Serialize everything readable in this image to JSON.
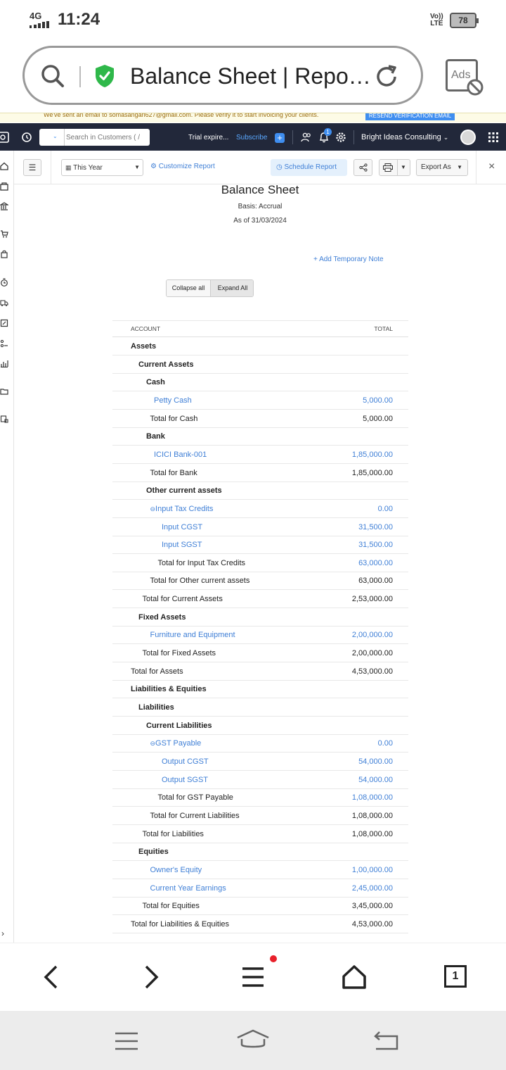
{
  "status_bar": {
    "network": "4G",
    "time": "11:24",
    "volte": "Vo\nLTE",
    "battery": "78"
  },
  "browser": {
    "page_title": "Balance Sheet | Repo…",
    "ads_label": "Ads"
  },
  "banner": {
    "text": "We've sent an email to somasangari627@gmail.com. Please verify it to start invoicing your clients.",
    "button": "RESEND VERIFICATION EMAIL"
  },
  "topnav": {
    "search_placeholder": "Search in Customers ( /",
    "trial": "Trial expire...",
    "subscribe": "Subscribe",
    "notifications": "1",
    "org": "Bright Ideas Consulting"
  },
  "toolbar": {
    "period": "This Year",
    "customize": "Customize Report",
    "schedule": "Schedule Report",
    "export": "Export As"
  },
  "report": {
    "title": "Balance Sheet",
    "basis": "Basis: Accrual",
    "as_of": "As of 31/03/2024",
    "add_note": "Add Temporary Note",
    "collapse": "Collapse all",
    "expand": "Expand All",
    "col_account": "ACCOUNT",
    "col_total": "TOTAL",
    "rows": [
      {
        "label": "Assets",
        "amount": "",
        "indent": 0,
        "style": "bold"
      },
      {
        "label": "Current Assets",
        "amount": "",
        "indent": 1,
        "style": "bold"
      },
      {
        "label": "Cash",
        "amount": "",
        "indent": 2,
        "style": "bold"
      },
      {
        "label": "Petty Cash",
        "amount": "5,000.00",
        "indent": 3,
        "style": "link"
      },
      {
        "label": "Total for Cash",
        "amount": "5,000.00",
        "indent": 2.5,
        "style": "total"
      },
      {
        "label": "Bank",
        "amount": "",
        "indent": 2,
        "style": "bold"
      },
      {
        "label": "ICICI Bank-001",
        "amount": "1,85,000.00",
        "indent": 3,
        "style": "link"
      },
      {
        "label": "Total for Bank",
        "amount": "1,85,000.00",
        "indent": 2.5,
        "style": "total"
      },
      {
        "label": "Other current assets",
        "amount": "",
        "indent": 2,
        "style": "bold"
      },
      {
        "label": "Input Tax Credits",
        "amount": "0.00",
        "indent": 2.5,
        "style": "link",
        "collapse": true
      },
      {
        "label": "Input CGST",
        "amount": "31,500.00",
        "indent": 4,
        "style": "link"
      },
      {
        "label": "Input SGST",
        "amount": "31,500.00",
        "indent": 4,
        "style": "link"
      },
      {
        "label": "Total for Input Tax Credits",
        "amount": "63,000.00",
        "indent": 3.5,
        "style": "subtotal-link"
      },
      {
        "label": "Total for Other current assets",
        "amount": "63,000.00",
        "indent": 2.5,
        "style": "total"
      },
      {
        "label": "Total for Current Assets",
        "amount": "2,53,000.00",
        "indent": 1.5,
        "style": "total"
      },
      {
        "label": "Fixed Assets",
        "amount": "",
        "indent": 1,
        "style": "bold"
      },
      {
        "label": "Furniture and Equipment",
        "amount": "2,00,000.00",
        "indent": 2.5,
        "style": "link"
      },
      {
        "label": "Total for Fixed Assets",
        "amount": "2,00,000.00",
        "indent": 1.5,
        "style": "total"
      },
      {
        "label": "Total for Assets",
        "amount": "4,53,000.00",
        "indent": 0,
        "style": "total"
      },
      {
        "label": "Liabilities & Equities",
        "amount": "",
        "indent": 0,
        "style": "bold"
      },
      {
        "label": "Liabilities",
        "amount": "",
        "indent": 1,
        "style": "bold"
      },
      {
        "label": "Current Liabilities",
        "amount": "",
        "indent": 2,
        "style": "bold"
      },
      {
        "label": "GST Payable",
        "amount": "0.00",
        "indent": 2.5,
        "style": "link",
        "collapse": true
      },
      {
        "label": "Output CGST",
        "amount": "54,000.00",
        "indent": 4,
        "style": "link"
      },
      {
        "label": "Output SGST",
        "amount": "54,000.00",
        "indent": 4,
        "style": "link"
      },
      {
        "label": "Total for GST Payable",
        "amount": "1,08,000.00",
        "indent": 3.5,
        "style": "subtotal-link"
      },
      {
        "label": "Total for Current Liabilities",
        "amount": "1,08,000.00",
        "indent": 2.5,
        "style": "total"
      },
      {
        "label": "Total for Liabilities",
        "amount": "1,08,000.00",
        "indent": 1.5,
        "style": "total"
      },
      {
        "label": "Equities",
        "amount": "",
        "indent": 1,
        "style": "bold"
      },
      {
        "label": "Owner's Equity",
        "amount": "1,00,000.00",
        "indent": 2.5,
        "style": "link"
      },
      {
        "label": "Current Year Earnings",
        "amount": "2,45,000.00",
        "indent": 2.5,
        "style": "link"
      },
      {
        "label": "Total for Equities",
        "amount": "3,45,000.00",
        "indent": 1.5,
        "style": "total"
      },
      {
        "label": "Total for Liabilities & Equities",
        "amount": "4,53,000.00",
        "indent": 0,
        "style": "total"
      }
    ]
  },
  "navbar": {
    "tabs_count": "1"
  },
  "colors": {
    "nav_bg": "#22283a",
    "link": "#3f7fd6",
    "accent": "#3f8ef0"
  }
}
